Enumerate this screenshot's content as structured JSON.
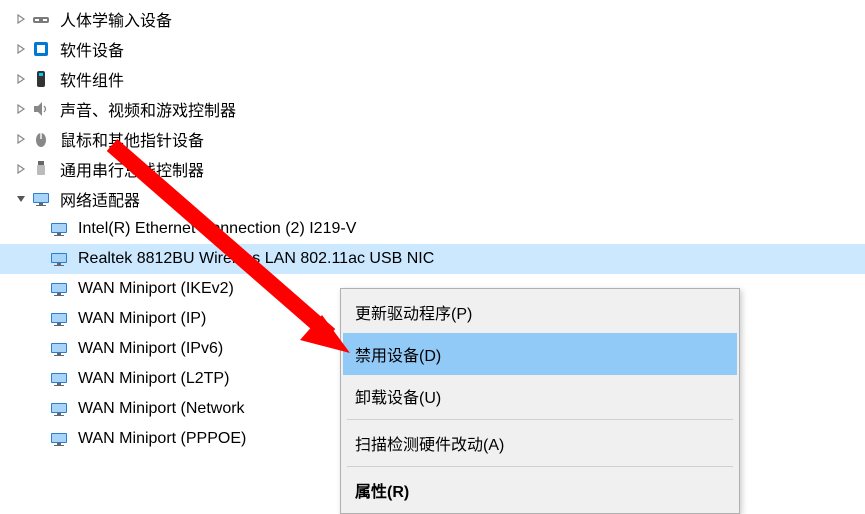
{
  "tree": {
    "categories": [
      {
        "label": "人体学输入设备",
        "icon": "hid-icon",
        "chevron": true
      },
      {
        "label": "软件设备",
        "icon": "software-device-icon",
        "chevron": true
      },
      {
        "label": "软件组件",
        "icon": "software-component-icon",
        "chevron": true
      },
      {
        "label": "声音、视频和游戏控制器",
        "icon": "sound-icon",
        "chevron": true
      },
      {
        "label": "鼠标和其他指针设备",
        "icon": "mouse-icon",
        "chevron": true
      },
      {
        "label": "通用串行总线控制器",
        "icon": "usb-icon",
        "chevron": true
      },
      {
        "label": "网络适配器",
        "icon": "network-icon",
        "chevron": true,
        "expanded": true
      }
    ],
    "network_adapters": [
      {
        "label": "Intel(R) Ethernet Connection (2) I219-V",
        "selected": false
      },
      {
        "label": "Realtek 8812BU Wireless LAN 802.11ac USB NIC",
        "selected": true
      },
      {
        "label": "WAN Miniport (IKEv2)",
        "selected": false
      },
      {
        "label": "WAN Miniport (IP)",
        "selected": false
      },
      {
        "label": "WAN Miniport (IPv6)",
        "selected": false
      },
      {
        "label": "WAN Miniport (L2TP)",
        "selected": false
      },
      {
        "label": "WAN Miniport (Network",
        "selected": false
      },
      {
        "label": "WAN Miniport (PPPOE)",
        "selected": false
      }
    ]
  },
  "context_menu": {
    "items": [
      {
        "label": "更新驱动程序(P)",
        "highlighted": false,
        "separator_after": false
      },
      {
        "label": "禁用设备(D)",
        "highlighted": true,
        "separator_after": false
      },
      {
        "label": "卸载设备(U)",
        "highlighted": false,
        "separator_after": true
      },
      {
        "label": "扫描检测硬件改动(A)",
        "highlighted": false,
        "separator_after": true
      },
      {
        "label": "属性(R)",
        "highlighted": false,
        "bold": true,
        "separator_after": false
      }
    ]
  },
  "arrow_annotation_color": "#ff0000"
}
